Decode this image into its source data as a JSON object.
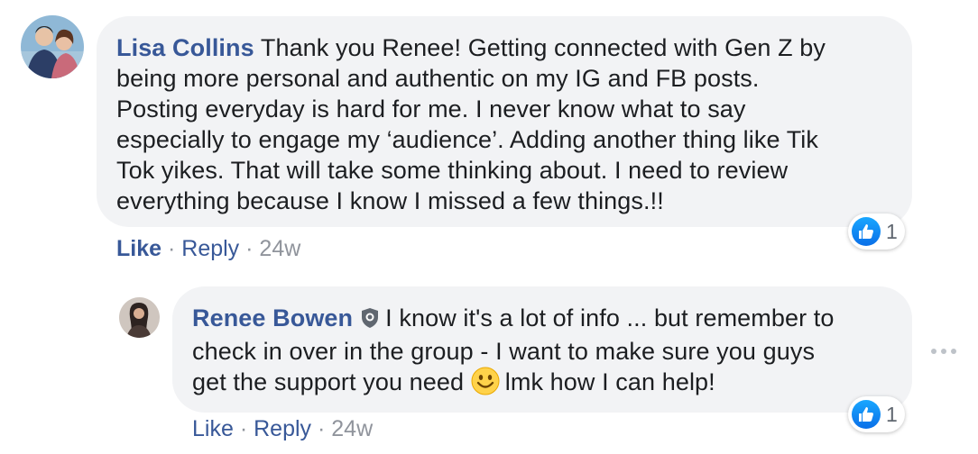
{
  "comment": {
    "author": "Lisa Collins",
    "lines": [
      "Thank you Renee! Getting connected with Gen Z by",
      "being more personal and authentic on my IG and FB posts.",
      "Posting everyday is hard for me. I never know what to say",
      "especially to engage my ‘audience’. Adding another thing like Tik",
      "Tok yikes. That will take some thinking about. I need to review",
      "everything because I know I missed a few things.!!"
    ],
    "actions": {
      "like": "Like",
      "reply": "Reply",
      "sep": "·",
      "time": "24w"
    },
    "reaction_count": "1"
  },
  "reply": {
    "author": "Renee Bowen",
    "lines": [
      "I know it's a lot of info ... but remember to",
      "check in over in the group - I want to make sure you guys",
      "get the support you need",
      "lmk how I can help!"
    ],
    "actions": {
      "like": "Like",
      "reply": "Reply",
      "sep": "·",
      "time": "24w"
    },
    "reaction_count": "1"
  },
  "colors": {
    "author": "#385898",
    "bubble": "#f2f3f5",
    "like_blue": "#0a6fe8"
  },
  "icons": [
    "avatar-photo",
    "verified-shield-icon",
    "smile-emoji-icon",
    "like-thumb-icon",
    "more-options-icon"
  ]
}
